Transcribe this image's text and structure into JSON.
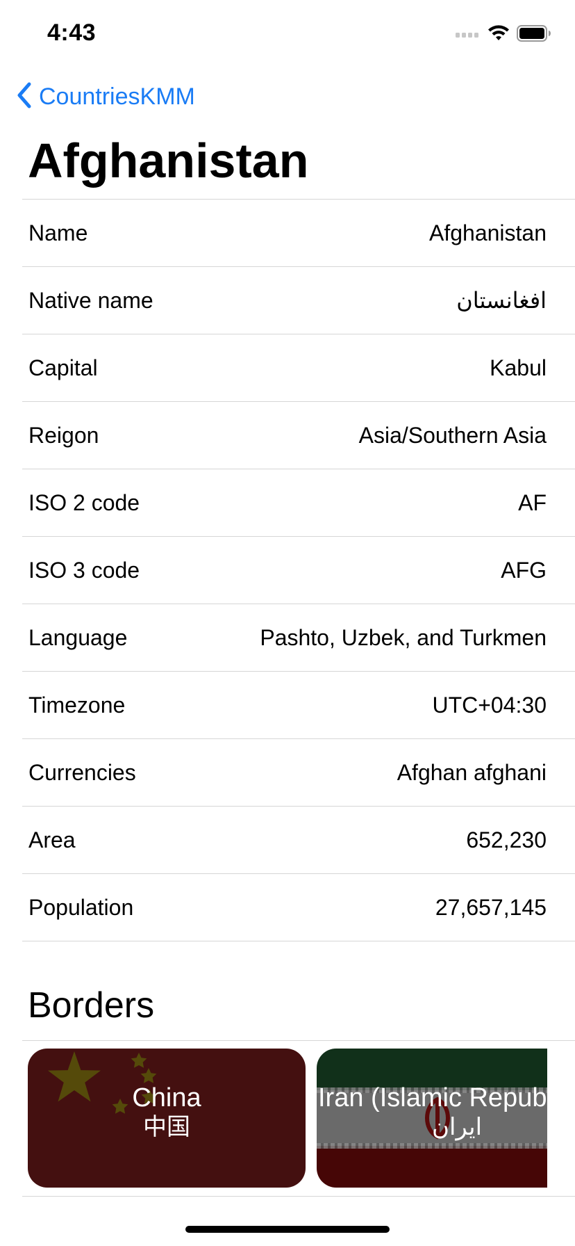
{
  "status_bar": {
    "time": "4:43",
    "icons": [
      "cellular-signal-icon",
      "wifi-icon",
      "battery-icon"
    ]
  },
  "nav": {
    "back_label": "CountriesKMM",
    "back_icon": "chevron-left-icon",
    "accent_color": "#1a7cf5"
  },
  "page": {
    "title": "Afghanistan"
  },
  "details": [
    {
      "label": "Name",
      "value": "Afghanistan"
    },
    {
      "label": "Native name",
      "value": "افغانستان"
    },
    {
      "label": "Capital",
      "value": "Kabul"
    },
    {
      "label": "Reigon",
      "value": "Asia/Southern Asia"
    },
    {
      "label": "ISO 2 code",
      "value": "AF"
    },
    {
      "label": "ISO 3 code",
      "value": "AFG"
    },
    {
      "label": "Language",
      "value": "Pashto, Uzbek, and Turkmen"
    },
    {
      "label": "Timezone",
      "value": "UTC+04:30"
    },
    {
      "label": "Currencies",
      "value": "Afghan afghani"
    },
    {
      "label": "Area",
      "value": "652,230"
    },
    {
      "label": "Population",
      "value": "27,657,145"
    }
  ],
  "borders": {
    "title": "Borders",
    "items": [
      {
        "name": "China",
        "native": "中国",
        "flag": "china-flag"
      },
      {
        "name": "Iran (Islamic Republic of)",
        "native": "ایران",
        "flag": "iran-flag"
      }
    ]
  }
}
